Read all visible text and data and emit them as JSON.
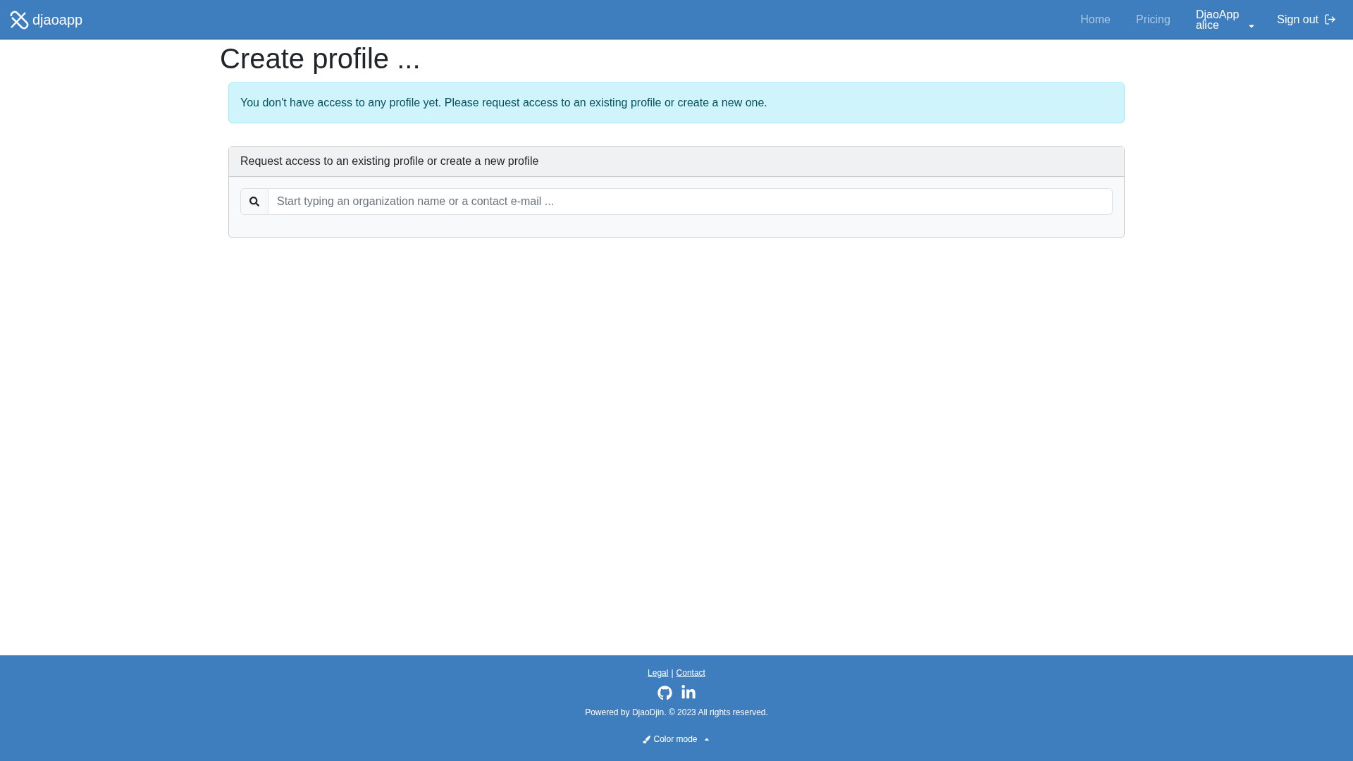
{
  "navbar": {
    "brand": "djaoapp",
    "links": [
      {
        "label": "Home"
      },
      {
        "label": "Pricing"
      }
    ],
    "account": {
      "line_1": "DjaoApp",
      "line_2": "alice"
    },
    "sign_out": "Sign out"
  },
  "page_title": "Create profile ...",
  "alert": "You don't have access to any profile yet. Please request access to an existing profile or create a new one.",
  "card": {
    "header": "Request access to an existing profile or create a new profile",
    "search": {
      "placeholder": "Start typing an organization name or a contact e-mail ..."
    }
  },
  "footer": {
    "links": [
      "Legal",
      "Contact"
    ],
    "separator": "|",
    "powered_by": "Powered by DjaoDjin. © 2023 All rights reserved.",
    "color_mode": "Color mode"
  }
}
